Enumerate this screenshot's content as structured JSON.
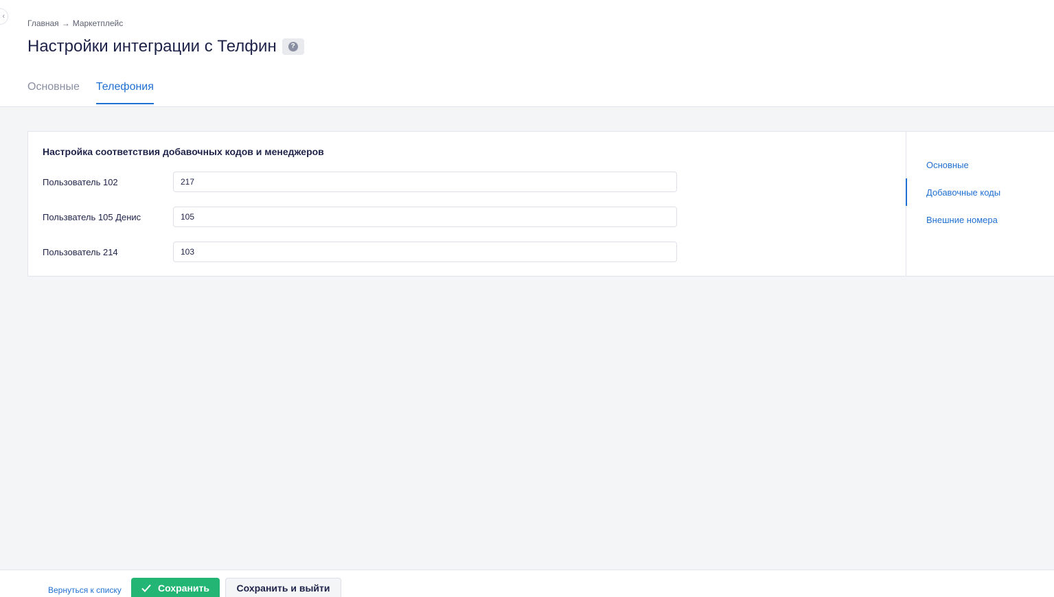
{
  "breadcrumb": {
    "home": "Главная",
    "arrow": "→",
    "marketplace": "Маркетплейс"
  },
  "page": {
    "title": "Настройки интеграции с Телфин",
    "help_icon": "question-circle-icon"
  },
  "tabs": [
    {
      "label": "Основные",
      "active": false
    },
    {
      "label": "Телефония",
      "active": true
    }
  ],
  "section": {
    "title": "Настройка соответствия добавочных кодов и менеджеров",
    "rows": [
      {
        "label": "Пользователь 102",
        "value": "217"
      },
      {
        "label": "Пользватель 105 Денис",
        "value": "105"
      },
      {
        "label": "Пользователь 214",
        "value": "103"
      }
    ]
  },
  "side_nav": {
    "items": [
      {
        "label": "Основные",
        "active": false
      },
      {
        "label": "Добавочные коды",
        "active": true
      },
      {
        "label": "Внешние номера",
        "active": false
      }
    ]
  },
  "footer": {
    "back_label": "Вернуться к списку",
    "save_label": "Сохранить",
    "save_exit_label": "Сохранить и выйти"
  },
  "colors": {
    "accent": "#1f6fd1",
    "save_button": "#22b573",
    "background": "#f4f5f7"
  }
}
